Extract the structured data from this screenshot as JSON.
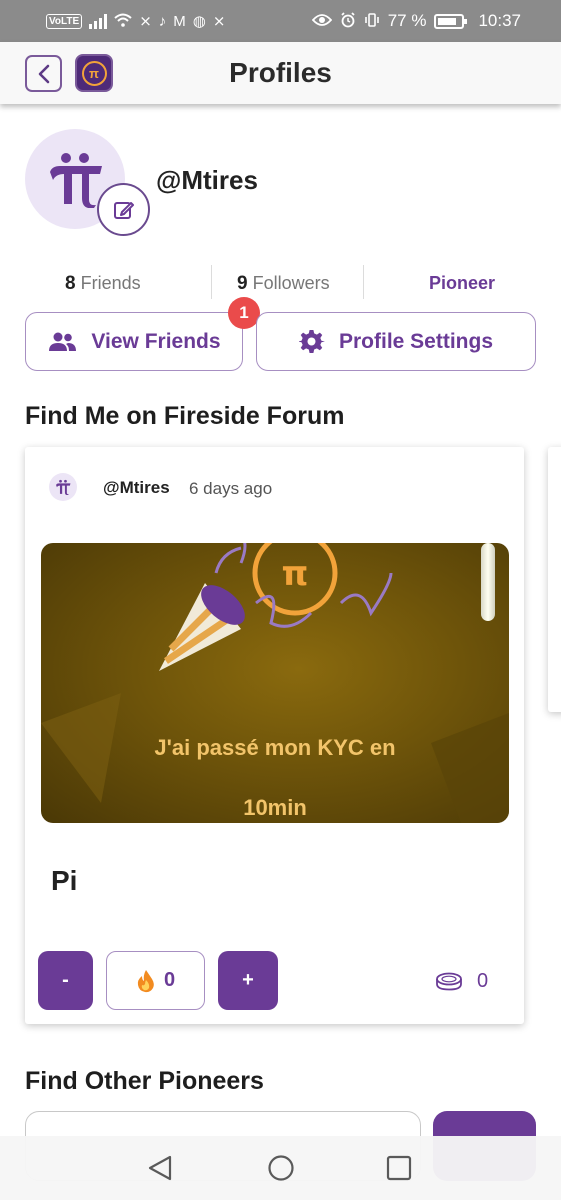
{
  "status_bar": {
    "volte": "VoLTE",
    "battery": "77 %",
    "time": "10:37"
  },
  "header": {
    "title": "Profiles"
  },
  "profile": {
    "username": "@Mtires",
    "stats": {
      "friends_count": "8",
      "friends_label": "Friends",
      "followers_count": "9",
      "followers_label": "Followers",
      "role": "Pioneer"
    },
    "view_friends_label": "View Friends",
    "notification_count": "1",
    "settings_label": "Profile Settings"
  },
  "fireside": {
    "title": "Find Me on Fireside Forum",
    "post": {
      "user": "@Mtires",
      "time": "6 days ago",
      "image_text_line1": "J'ai passé mon KYC en",
      "image_text_line2": "10min",
      "text": "Pi",
      "downvote_label": "-",
      "fire_count": "0",
      "upvote_label": "+",
      "coin_count": "0"
    }
  },
  "pioneers": {
    "title": "Find Other Pioneers"
  },
  "colors": {
    "brand_purple": "#6a3b96",
    "badge_red": "#ea4b4b",
    "pi_gold": "#f2a33a"
  }
}
